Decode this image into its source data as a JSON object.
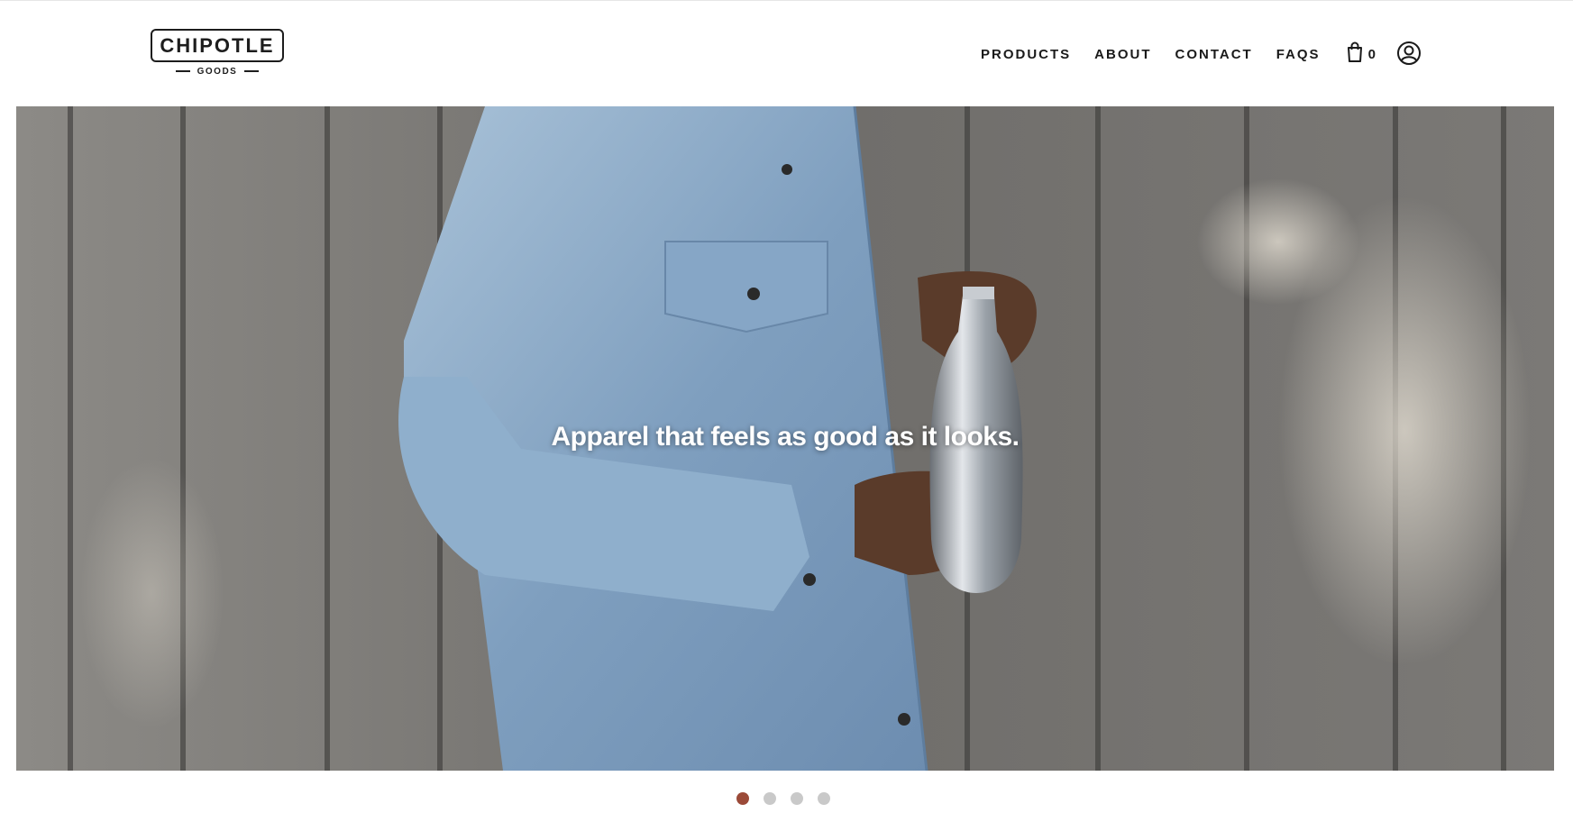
{
  "logo": {
    "name": "CHIPOTLE",
    "sub": "GOODS"
  },
  "nav": {
    "items": [
      {
        "label": "PRODUCTS"
      },
      {
        "label": "ABOUT"
      },
      {
        "label": "CONTACT"
      },
      {
        "label": "FAQS"
      }
    ],
    "cart": {
      "icon": "shopping-bag-icon",
      "count": "0"
    },
    "account": {
      "icon": "account-circle-icon"
    }
  },
  "hero": {
    "caption": "Apparel that feels as good as it looks.",
    "slides_total": 4,
    "active_slide": 1
  },
  "colors": {
    "text": "#1a1a1a",
    "dot_active": "#9b4a38",
    "dot_inactive": "#c9c9c9"
  }
}
